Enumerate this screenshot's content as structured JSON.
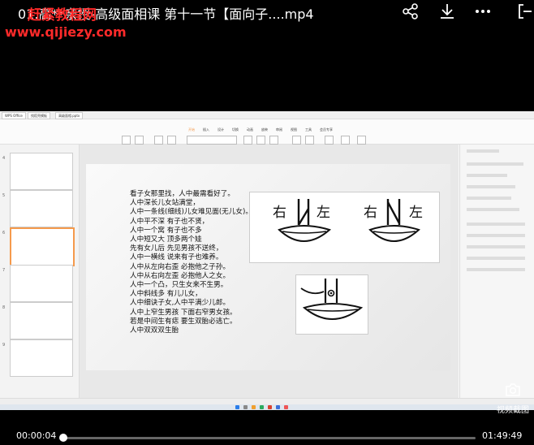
{
  "header": {
    "title": "01.高**亲授-高级面相课 第十一节【面向子....mp4",
    "watermark_name": "赶紧教程网",
    "watermark_url": "www.qijiezy.com"
  },
  "icons": [
    "share-icon",
    "download-icon",
    "more-icon",
    "exit-icon",
    "camera-icon"
  ],
  "wps": {
    "tabs": [
      "WPS Office",
      "找稻壳模板",
      "高级面相.pptx"
    ],
    "ribbon_tabs": [
      "开始",
      "插入",
      "设计",
      "切换",
      "动画",
      "放映",
      "审阅",
      "视图",
      "工具",
      "会员专享"
    ]
  },
  "slide": {
    "lines": [
      "看子女那里找，人中最需看好了。",
      "人中深长儿女站满堂，",
      "人中一条线(细线)儿女难见面(无儿女)。",
      "人中平不深 有子也不贤，",
      "人中一个窝 有子也不多",
      "人中短又大 顶多两个娃",
      "先有女儿后 先见男孩不送终，",
      "人中一横线 说来有子也难养。",
      "人中从左向右歪 必抱他之子孙。",
      "人中从右向左歪 必抱他人之女。",
      "人中一个凸，只生女来不生男。",
      "人中斜线多 有儿儿女，",
      "人中细诀子女,人中平满少儿郎。",
      "人中上窄生男孩 下面右窄男女孩。",
      "若是中间生有痣 要生双胎必逃亡。",
      "人中双双双生胎"
    ],
    "image_labels": [
      "右",
      "左",
      "右",
      "左"
    ]
  },
  "player": {
    "current_time": "00:00:04",
    "duration": "01:49:49",
    "progress": 0.0006,
    "snapshot_label": "视频截图"
  },
  "colors": {
    "watermark": "#ff2a2a",
    "accent": "#f59a4c",
    "background": "#000000"
  }
}
